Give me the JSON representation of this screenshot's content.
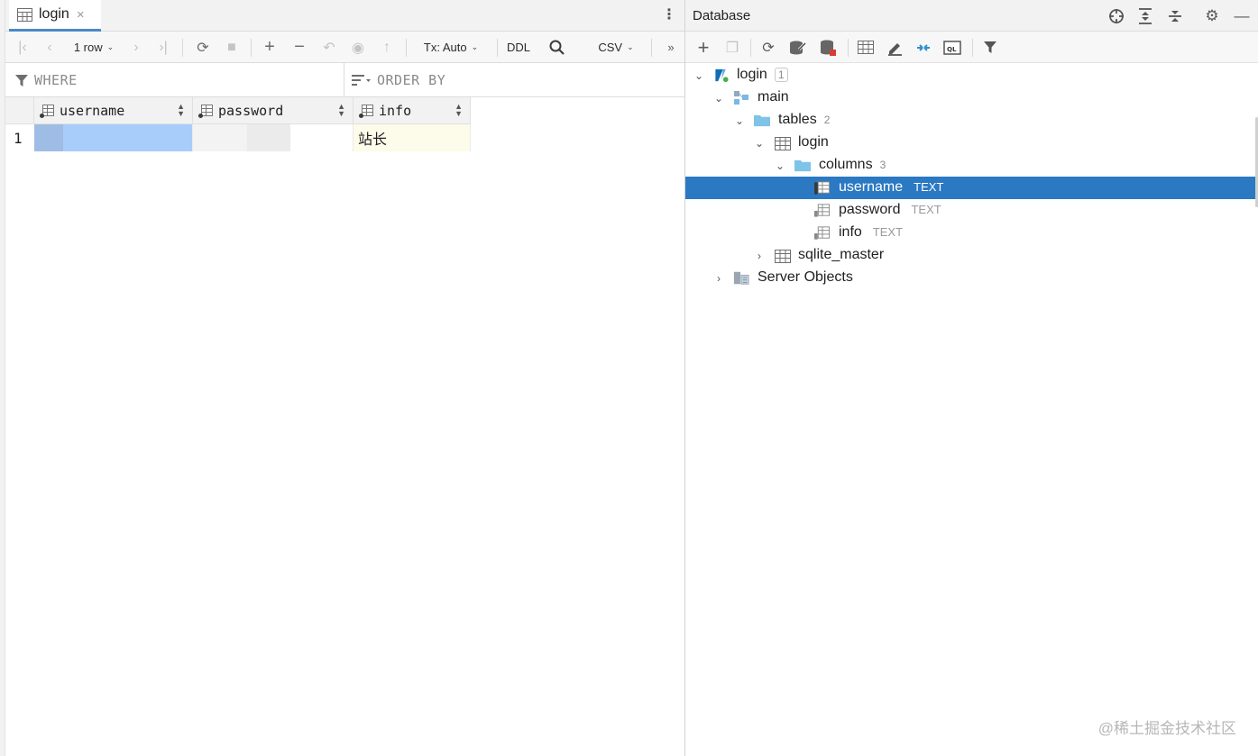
{
  "editor": {
    "tab": {
      "label": "login",
      "close": "×",
      "icon": "table-icon"
    },
    "toolbar": {
      "row_count": "1 row",
      "tx_mode": "Tx: Auto",
      "ddl": "DDL",
      "export_format": "CSV",
      "more": "»"
    },
    "filter": {
      "where": "WHERE",
      "order_by": "ORDER BY"
    },
    "grid": {
      "columns": [
        "username",
        "password",
        "info"
      ],
      "rows": [
        {
          "num": "1",
          "username": "",
          "password": "",
          "info": "站长"
        }
      ]
    }
  },
  "database": {
    "title": "Database",
    "tree": {
      "root": {
        "label": "login",
        "count": "1"
      },
      "schema": {
        "label": "main"
      },
      "tables": {
        "label": "tables",
        "count": "2"
      },
      "table_login": {
        "label": "login"
      },
      "columns": {
        "label": "columns",
        "count": "3"
      },
      "column_items": [
        {
          "label": "username",
          "type": "TEXT"
        },
        {
          "label": "password",
          "type": "TEXT"
        },
        {
          "label": "info",
          "type": "TEXT"
        }
      ],
      "sqlite_master": {
        "label": "sqlite_master"
      },
      "server_objects": {
        "label": "Server Objects"
      }
    }
  },
  "watermark": "@稀土掘金技术社区",
  "colors": {
    "selection": "#2b79c2",
    "tab_underline": "#4a88c7",
    "cell_bg": "#fdfbe9",
    "folder": "#7fc3e8"
  }
}
